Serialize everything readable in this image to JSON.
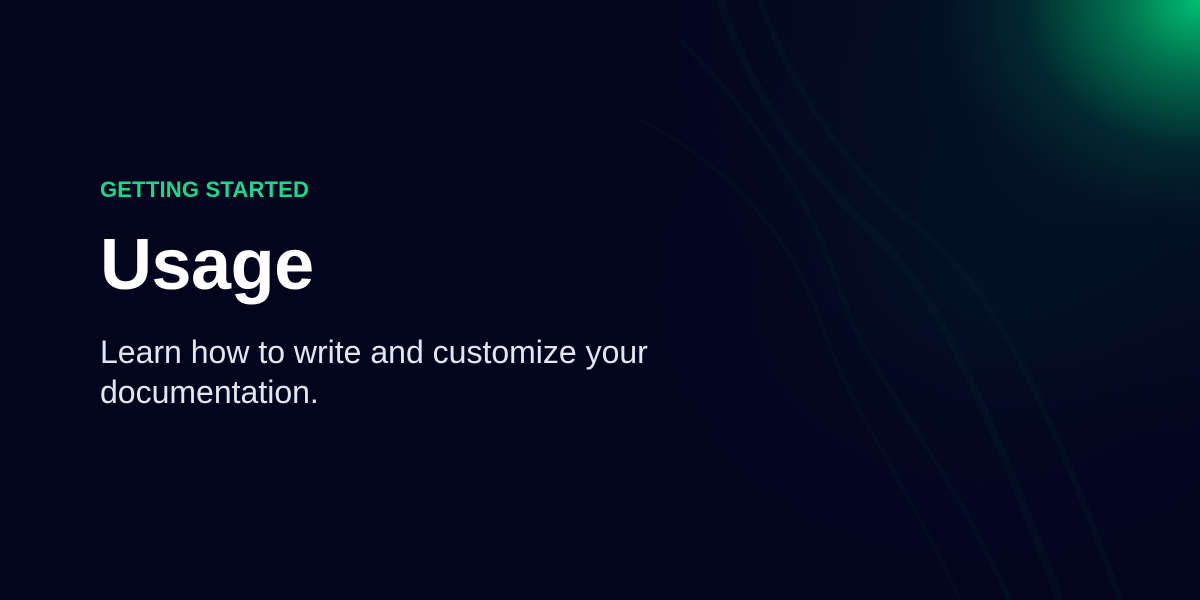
{
  "header": {
    "eyebrow": "GETTING STARTED",
    "title": "Usage",
    "subtitle": "Learn how to write and customize your documentation."
  },
  "colors": {
    "background": "#03051f",
    "accent": "#1dd88c",
    "title": "#ffffff",
    "subtitle": "#e3e6f1"
  }
}
